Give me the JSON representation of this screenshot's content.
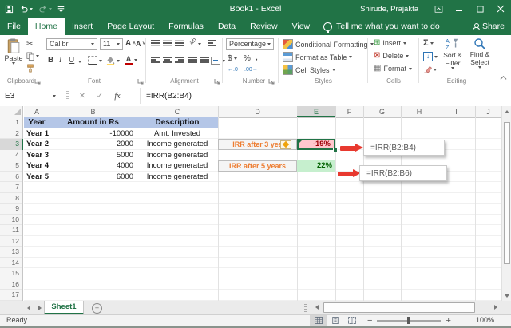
{
  "title_bar": {
    "title": "Book1 - Excel",
    "user": "Shirude, Prajakta"
  },
  "tabs": [
    {
      "label": "File"
    },
    {
      "label": "Home"
    },
    {
      "label": "Insert"
    },
    {
      "label": "Page Layout"
    },
    {
      "label": "Formulas"
    },
    {
      "label": "Data"
    },
    {
      "label": "Review"
    },
    {
      "label": "View"
    }
  ],
  "tell_me": "Tell me what you want to do",
  "share_label": "Share",
  "ribbon": {
    "clipboard": {
      "group_label": "Clipboard",
      "paste_label": "Paste"
    },
    "font": {
      "group_label": "Font",
      "font_name": "Calibri",
      "font_size": "11",
      "bold": "B",
      "italic": "I",
      "underline": "U"
    },
    "alignment": {
      "group_label": "Alignment"
    },
    "number": {
      "group_label": "Number",
      "format": "Percentage",
      "currency": "$",
      "percent": "%",
      "comma": ",",
      "inc_decimal": "←.0",
      "dec_decimal": ".00→"
    },
    "styles": {
      "group_label": "Styles",
      "conditional_formatting": "Conditional Formatting",
      "format_as_table": "Format as Table",
      "cell_styles": "Cell Styles"
    },
    "cells": {
      "group_label": "Cells",
      "insert": "Insert",
      "delete": "Delete",
      "format": "Format"
    },
    "editing": {
      "group_label": "Editing",
      "autosum": "Σ",
      "sort_filter": "Sort & Filter",
      "find_select": "Find & Select"
    }
  },
  "formula_bar": {
    "name_box": "E3",
    "fx": "fx",
    "formula": "=IRR(B2:B4)"
  },
  "grid": {
    "columns": [
      "A",
      "B",
      "C",
      "D",
      "E",
      "F",
      "G",
      "H",
      "I",
      "J"
    ],
    "selected_column": "E",
    "selected_row": "3",
    "row_numbers": [
      "1",
      "2",
      "3",
      "4",
      "5",
      "6",
      "7",
      "8",
      "9",
      "10",
      "11",
      "12",
      "13",
      "14",
      "15",
      "16",
      "17"
    ],
    "header_cells": {
      "a": "Year",
      "b": "Amount in Rs",
      "c": "Description"
    },
    "rows": [
      {
        "year": "Year 1",
        "amount": "-10000",
        "desc": "Amt. Invested"
      },
      {
        "year": "Year 2",
        "amount": "2000",
        "desc": "Income generated"
      },
      {
        "year": "Year 3",
        "amount": "5000",
        "desc": "Income generated"
      },
      {
        "year": "Year 4",
        "amount": "4000",
        "desc": "Income generated"
      },
      {
        "year": "Year 5",
        "amount": "6000",
        "desc": "Income generated"
      }
    ],
    "irr3_label": "IRR after 3 yea",
    "irr3_value": "-19%",
    "irr5_label": "IRR after 5 years",
    "irr5_value": "22%",
    "callout1": "=IRR(B2:B4)",
    "callout2": "=IRR(B2:B6)"
  },
  "sheet_tabs": {
    "sheet1": "Sheet1"
  },
  "status_bar": {
    "ready": "Ready",
    "zoom": "100%"
  },
  "colors": {
    "excel_green": "#217346",
    "header_fill": "#B4C6E7",
    "label_orange": "#ED7D31",
    "negative_bg": "#FFC7CE",
    "negative_text": "#9C0006",
    "positive_bg": "#C6EFCE",
    "positive_text": "#006100",
    "arrow_red": "#E8392F"
  }
}
